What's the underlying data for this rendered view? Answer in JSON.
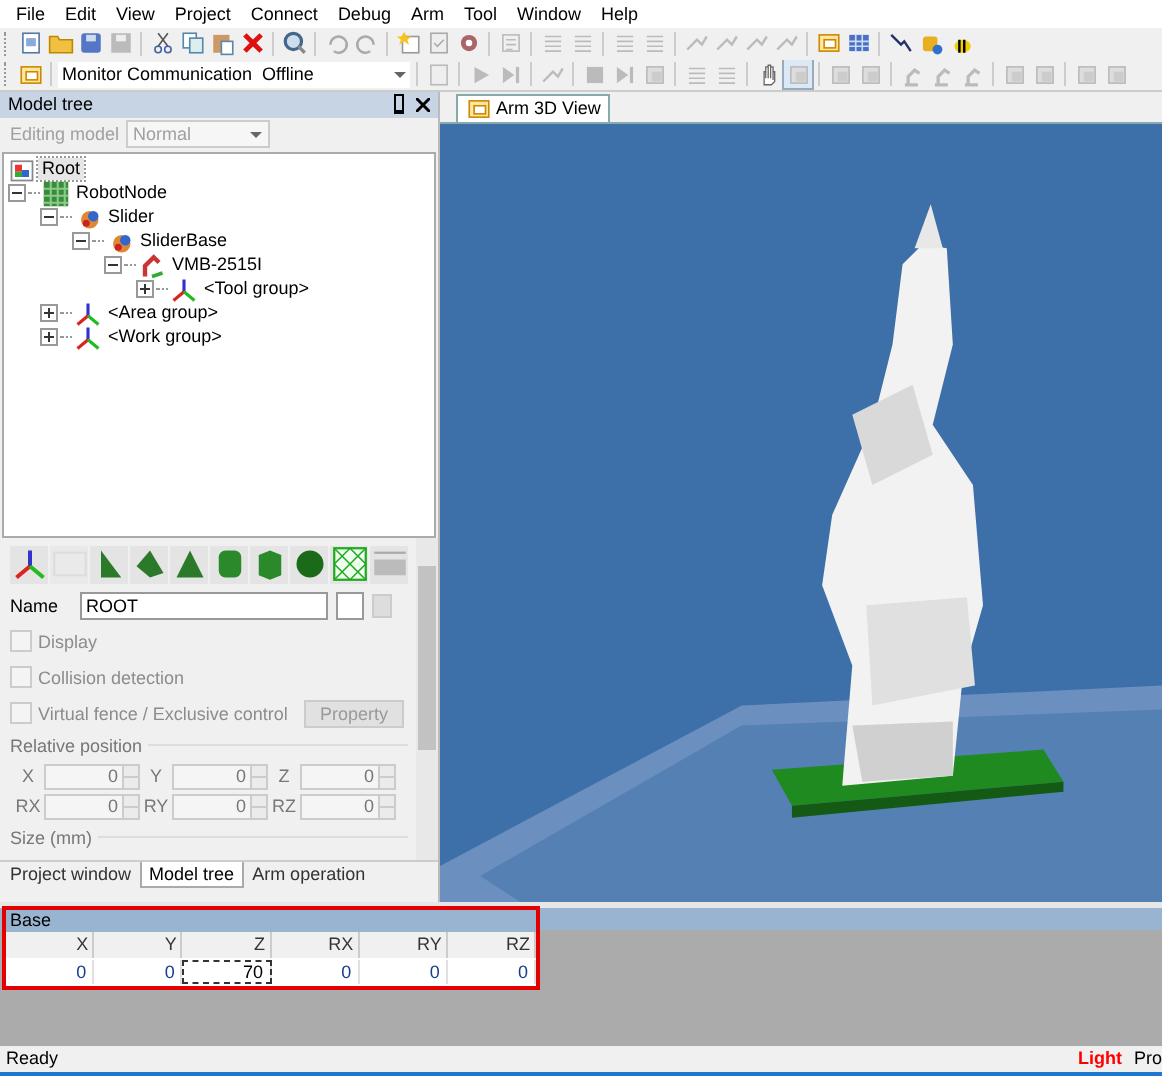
{
  "menu": [
    "File",
    "Edit",
    "View",
    "Project",
    "Connect",
    "Debug",
    "Arm",
    "Tool",
    "Window",
    "Help"
  ],
  "monitor_combo": {
    "value": "Monitor Communication  Offline"
  },
  "model_tree_panel": {
    "title": "Model tree",
    "editing_mode": {
      "label": "Editing model",
      "value": "Normal",
      "disabled": true
    },
    "tree": [
      {
        "label": "Root",
        "kind": "root",
        "selected": true
      },
      {
        "label": "RobotNode",
        "kind": "grid",
        "selected": false,
        "expanded": true,
        "children": [
          {
            "label": "Slider",
            "kind": "part",
            "selected": false,
            "expanded": true,
            "children": [
              {
                "label": "SliderBase",
                "kind": "part",
                "selected": false,
                "expanded": true,
                "children": [
                  {
                    "label": "VMB-2515I",
                    "kind": "robot",
                    "selected": false,
                    "expanded": true,
                    "children": [
                      {
                        "label": "<Tool group>",
                        "kind": "frame",
                        "selected": false,
                        "expanded": false
                      }
                    ]
                  }
                ]
              }
            ]
          },
          {
            "label": "<Area group>",
            "kind": "frame",
            "selected": false,
            "expanded": false
          },
          {
            "label": "<Work group>",
            "kind": "frame",
            "selected": false,
            "expanded": false
          }
        ]
      }
    ],
    "properties": {
      "name_label": "Name",
      "name_value": "ROOT",
      "checkboxes": [
        {
          "label": "Display",
          "checked": false,
          "disabled": true
        },
        {
          "label": "Collision detection",
          "checked": false,
          "disabled": true
        },
        {
          "label": "Virtual fence / Exclusive control",
          "checked": false,
          "disabled": true
        }
      ],
      "property_button": {
        "label": "Property",
        "disabled": true
      },
      "relative_position": {
        "title": "Relative position",
        "fields": [
          {
            "label": "X",
            "value": "0",
            "disabled": true
          },
          {
            "label": "Y",
            "value": "0",
            "disabled": true
          },
          {
            "label": "Z",
            "value": "0",
            "disabled": true
          },
          {
            "label": "RX",
            "value": "0",
            "disabled": true
          },
          {
            "label": "RY",
            "value": "0",
            "disabled": true
          },
          {
            "label": "RZ",
            "value": "0",
            "disabled": true
          }
        ]
      },
      "size_title": "Size (mm)"
    },
    "tabs": [
      {
        "label": "Project window",
        "selected": false
      },
      {
        "label": "Model tree",
        "selected": true
      },
      {
        "label": "Arm operation",
        "selected": false
      }
    ]
  },
  "document_tab": {
    "label": "Arm 3D View",
    "selected": true
  },
  "base_panel": {
    "title": "Base",
    "columns": [
      "X",
      "Y",
      "Z",
      "RX",
      "RY",
      "RZ"
    ],
    "values": [
      {
        "value": "0",
        "focused": false
      },
      {
        "value": "0",
        "focused": false
      },
      {
        "value": "70",
        "focused": true
      },
      {
        "value": "0",
        "focused": false
      },
      {
        "value": "0",
        "focused": false
      },
      {
        "value": "0",
        "focused": false
      }
    ]
  },
  "status_bar": {
    "message": "Ready",
    "indicators": [
      {
        "text": "Light",
        "color": "#ff0000"
      },
      {
        "text": "Pro",
        "color": "#000000"
      }
    ]
  }
}
